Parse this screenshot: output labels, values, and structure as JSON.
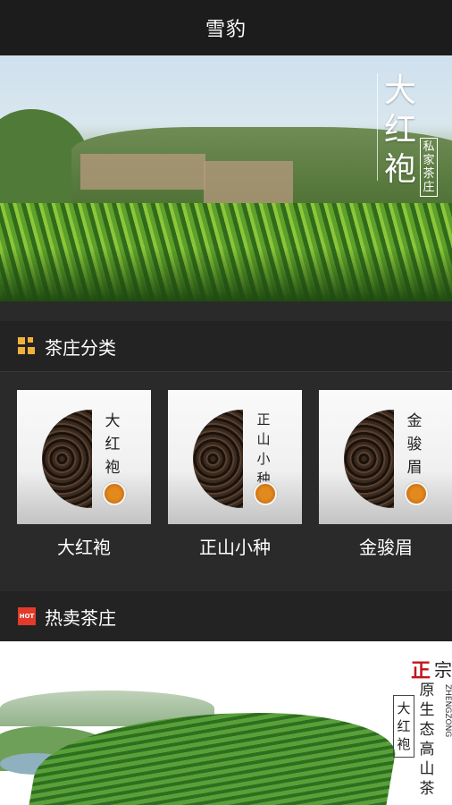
{
  "header": {
    "title": "雪豹"
  },
  "banner": {
    "title_chars": [
      "大",
      "红",
      "袍"
    ],
    "tag_chars": [
      "私",
      "家",
      "茶",
      "庄"
    ]
  },
  "categories_section": {
    "title": "茶庄分类",
    "items": [
      {
        "label": "大红袍",
        "card_chars": [
          "大",
          "红",
          "袍"
        ]
      },
      {
        "label": "正山小种",
        "card_chars": [
          "正",
          "山",
          "小",
          "种"
        ]
      },
      {
        "label": "金骏眉",
        "card_chars": [
          "金",
          "骏",
          "眉"
        ]
      }
    ]
  },
  "hot_section": {
    "title": "热卖茶庄",
    "badge": "HOT",
    "banner": {
      "brand_red": "正",
      "brand_black": "宗",
      "slogan_chars": [
        "原",
        "生",
        "态",
        "高",
        "山",
        "茶"
      ],
      "english": "ZHENGZONG",
      "box_chars": [
        "大",
        "红",
        "袍"
      ]
    }
  },
  "colors": {
    "accent": "#f2b23a",
    "hot_red": "#e23a2b",
    "bar": "#1c1c1c"
  }
}
